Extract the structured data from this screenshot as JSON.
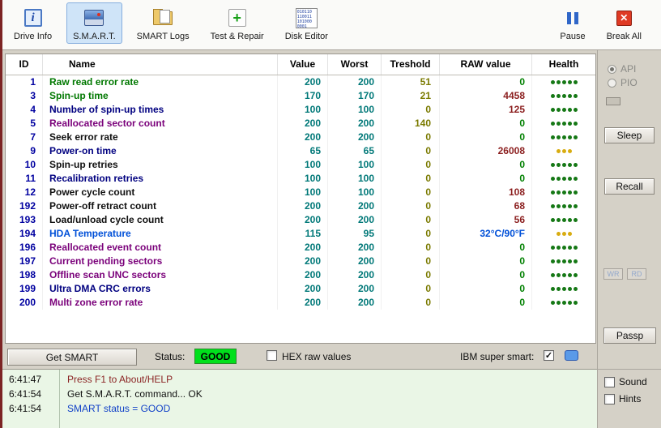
{
  "toolbar": {
    "buttons": [
      {
        "label": "Drive Info"
      },
      {
        "label": "S.M.A.R.T.",
        "selected": true
      },
      {
        "label": "SMART Logs"
      },
      {
        "label": "Test & Repair"
      },
      {
        "label": "Disk Editor",
        "icon_text": "010110 110011 101000 0001"
      }
    ],
    "pause_label": "Pause",
    "break_label": "Break All"
  },
  "table": {
    "headers": [
      "ID",
      "Name",
      "Value",
      "Worst",
      "Treshold",
      "RAW value",
      "Health"
    ],
    "rows": [
      {
        "id": "1",
        "name": "Raw read error rate",
        "name_color": "#007800",
        "value": "200",
        "worst": "200",
        "treshold": "51",
        "raw": "0",
        "raw_color": "#008000",
        "health_dots": 5,
        "health_color": "#157815"
      },
      {
        "id": "3",
        "name": "Spin-up time",
        "name_color": "#007800",
        "value": "170",
        "worst": "170",
        "treshold": "21",
        "raw": "4458",
        "raw_color": "#8b1e1e",
        "health_dots": 5,
        "health_color": "#157815"
      },
      {
        "id": "4",
        "name": "Number of spin-up times",
        "name_color": "#000080",
        "value": "100",
        "worst": "100",
        "treshold": "0",
        "raw": "125",
        "raw_color": "#8b1e1e",
        "health_dots": 5,
        "health_color": "#157815"
      },
      {
        "id": "5",
        "name": "Reallocated sector count",
        "name_color": "#7a007a",
        "value": "200",
        "worst": "200",
        "treshold": "140",
        "raw": "0",
        "raw_color": "#008000",
        "health_dots": 5,
        "health_color": "#157815"
      },
      {
        "id": "7",
        "name": "Seek error rate",
        "name_color": "#101010",
        "value": "200",
        "worst": "200",
        "treshold": "0",
        "raw": "0",
        "raw_color": "#008000",
        "health_dots": 5,
        "health_color": "#157815"
      },
      {
        "id": "9",
        "name": "Power-on time",
        "name_color": "#000080",
        "value": "65",
        "worst": "65",
        "treshold": "0",
        "raw": "26008",
        "raw_color": "#8b1e1e",
        "health_dots": 3,
        "health_color": "#d8ac10"
      },
      {
        "id": "10",
        "name": "Spin-up retries",
        "name_color": "#101010",
        "value": "100",
        "worst": "100",
        "treshold": "0",
        "raw": "0",
        "raw_color": "#008000",
        "health_dots": 5,
        "health_color": "#157815"
      },
      {
        "id": "11",
        "name": "Recalibration retries",
        "name_color": "#000080",
        "value": "100",
        "worst": "100",
        "treshold": "0",
        "raw": "0",
        "raw_color": "#008000",
        "health_dots": 5,
        "health_color": "#157815"
      },
      {
        "id": "12",
        "name": "Power cycle count",
        "name_color": "#101010",
        "value": "100",
        "worst": "100",
        "treshold": "0",
        "raw": "108",
        "raw_color": "#8b1e1e",
        "health_dots": 5,
        "health_color": "#157815"
      },
      {
        "id": "192",
        "name": "Power-off retract count",
        "name_color": "#101010",
        "value": "200",
        "worst": "200",
        "treshold": "0",
        "raw": "68",
        "raw_color": "#8b1e1e",
        "health_dots": 5,
        "health_color": "#157815"
      },
      {
        "id": "193",
        "name": "Load/unload cycle count",
        "name_color": "#101010",
        "value": "200",
        "worst": "200",
        "treshold": "0",
        "raw": "56",
        "raw_color": "#8b1e1e",
        "health_dots": 5,
        "health_color": "#157815"
      },
      {
        "id": "194",
        "name": "HDA Temperature",
        "name_color": "#0050d8",
        "value": "115",
        "worst": "95",
        "treshold": "0",
        "raw": "32°C/90°F",
        "raw_color": "#0050d8",
        "health_dots": 3,
        "health_color": "#d8ac10"
      },
      {
        "id": "196",
        "name": "Reallocated event count",
        "name_color": "#7a007a",
        "value": "200",
        "worst": "200",
        "treshold": "0",
        "raw": "0",
        "raw_color": "#008000",
        "health_dots": 5,
        "health_color": "#157815"
      },
      {
        "id": "197",
        "name": "Current pending sectors",
        "name_color": "#7a007a",
        "value": "200",
        "worst": "200",
        "treshold": "0",
        "raw": "0",
        "raw_color": "#008000",
        "health_dots": 5,
        "health_color": "#157815"
      },
      {
        "id": "198",
        "name": "Offline scan UNC sectors",
        "name_color": "#7a007a",
        "value": "200",
        "worst": "200",
        "treshold": "0",
        "raw": "0",
        "raw_color": "#008000",
        "health_dots": 5,
        "health_color": "#157815"
      },
      {
        "id": "199",
        "name": "Ultra DMA CRC errors",
        "name_color": "#000080",
        "value": "200",
        "worst": "200",
        "treshold": "0",
        "raw": "0",
        "raw_color": "#008000",
        "health_dots": 5,
        "health_color": "#157815"
      },
      {
        "id": "200",
        "name": "Multi zone error rate",
        "name_color": "#7a007a",
        "value": "200",
        "worst": "200",
        "treshold": "0",
        "raw": "0",
        "raw_color": "#008000",
        "health_dots": 5,
        "health_color": "#157815"
      }
    ]
  },
  "controls": {
    "get_smart": "Get SMART",
    "status_label": "Status:",
    "status_value": "GOOD",
    "status_color": "#00e01c",
    "hex_label": "HEX raw values",
    "hex_checked": false,
    "ibm_label": "IBM super smart:",
    "ibm_checked": true
  },
  "side_panel": {
    "api": "API",
    "pio": "PIO",
    "api_selected": true,
    "sleep": "Sleep",
    "recall": "Recall",
    "wr": "WR",
    "rd": "RD",
    "passp": "Passp"
  },
  "log": {
    "entries": [
      {
        "time": "6:41:47",
        "message": "Press F1 to About/HELP",
        "color": "#8b2424"
      },
      {
        "time": "6:41:54",
        "message": "Get S.M.A.R.T. command... OK",
        "color": "#101010"
      },
      {
        "time": "6:41:54",
        "message": "SMART status = GOOD",
        "color": "#1242c8"
      }
    ]
  },
  "options": {
    "sound": "Sound",
    "hints": "Hints"
  }
}
